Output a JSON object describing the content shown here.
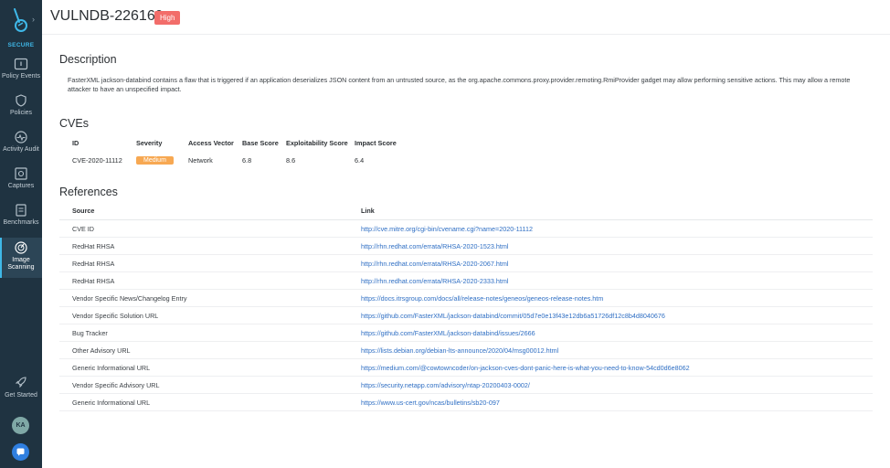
{
  "sidebar": {
    "brand_label": "SECURE",
    "items": [
      {
        "label": "Policy Events",
        "icon": "policy-events-icon"
      },
      {
        "label": "Policies",
        "icon": "policies-icon"
      },
      {
        "label": "Activity Audit",
        "icon": "activity-audit-icon"
      },
      {
        "label": "Captures",
        "icon": "captures-icon"
      },
      {
        "label": "Benchmarks",
        "icon": "benchmarks-icon"
      },
      {
        "label": "Image Scanning",
        "icon": "image-scanning-icon",
        "active": true
      },
      {
        "label": "Get Started",
        "icon": "rocket-icon"
      }
    ],
    "avatar_initials": "KA"
  },
  "header": {
    "title": "VULNDB-226169",
    "severity": "High"
  },
  "description": {
    "heading": "Description",
    "text": "FasterXML jackson-databind contains a flaw that is triggered if an application deserializes JSON content from an untrusted source, as the org.apache.commons.proxy.provider.remoting.RmiProvider gadget may allow performing sensitive actions. This may allow a remote attacker to have an unspecified impact."
  },
  "cves": {
    "heading": "CVEs",
    "columns": [
      "ID",
      "Severity",
      "Access Vector",
      "Base Score",
      "Exploitability Score",
      "Impact Score"
    ],
    "rows": [
      {
        "id": "CVE-2020-11112",
        "severity": "Medium",
        "access_vector": "Network",
        "base_score": "6.8",
        "exploitability_score": "8.6",
        "impact_score": "6.4"
      }
    ]
  },
  "references": {
    "heading": "References",
    "columns": [
      "Source",
      "Link"
    ],
    "rows": [
      {
        "source": "CVE ID",
        "link": "http://cve.mitre.org/cgi-bin/cvename.cgi?name=2020-11112"
      },
      {
        "source": "RedHat RHSA",
        "link": "http://rhn.redhat.com/errata/RHSA-2020-1523.html"
      },
      {
        "source": "RedHat RHSA",
        "link": "http://rhn.redhat.com/errata/RHSA-2020-2067.html"
      },
      {
        "source": "RedHat RHSA",
        "link": "http://rhn.redhat.com/errata/RHSA-2020-2333.html"
      },
      {
        "source": "Vendor Specific News/Changelog Entry",
        "link": "https://docs.itrsgroup.com/docs/all/release-notes/geneos/geneos-release-notes.htm"
      },
      {
        "source": "Vendor Specific Solution URL",
        "link": "https://github.com/FasterXML/jackson-databind/commit/05d7e0e13f43e12db6a51726df12c8b4d8040676"
      },
      {
        "source": "Bug Tracker",
        "link": "https://github.com/FasterXML/jackson-databind/issues/2666"
      },
      {
        "source": "Other Advisory URL",
        "link": "https://lists.debian.org/debian-lts-announce/2020/04/msg00012.html"
      },
      {
        "source": "Generic Informational URL",
        "link": "https://medium.com/@cowtowncoder/on-jackson-cves-dont-panic-here-is-what-you-need-to-know-54cd0d6e8062"
      },
      {
        "source": "Vendor Specific Advisory URL",
        "link": "https://security.netapp.com/advisory/ntap-20200403-0002/"
      },
      {
        "source": "Generic Informational URL",
        "link": "https://www.us-cert.gov/ncas/bulletins/sb20-097"
      }
    ]
  },
  "colors": {
    "sidebar_bg": "#1f3341",
    "accent": "#3fb8e8",
    "high_badge": "#f26d6a",
    "medium_badge": "#f7a852",
    "link": "#2f6fc4"
  }
}
